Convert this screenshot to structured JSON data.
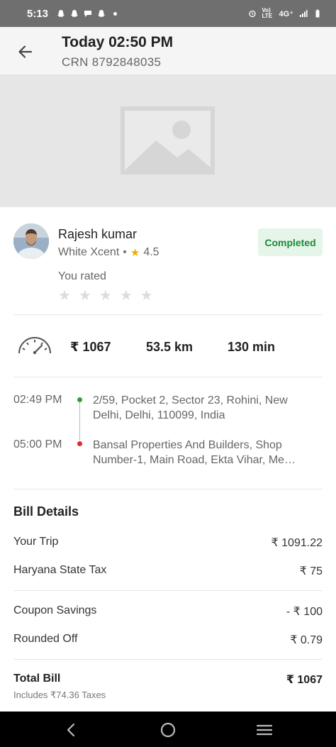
{
  "status_bar": {
    "time": "5:13",
    "network": "4G⁺",
    "volte": "Vo) LTE"
  },
  "header": {
    "title": "Today 02:50 PM",
    "crn": "CRN 8792848035"
  },
  "driver": {
    "name": "Rajesh kumar",
    "car": "White Xcent",
    "separator": "•",
    "rating": "4.5",
    "status": "Completed",
    "you_rated": "You rated",
    "user_stars": 0
  },
  "trip": {
    "fare": "₹ 1067",
    "distance": "53.5 km",
    "duration": "130 min"
  },
  "route": {
    "pickup_time": "02:49 PM",
    "pickup_address": "2/59, Pocket 2, Sector 23, Rohini, New Delhi, Delhi, 110099, India",
    "drop_time": "05:00 PM",
    "drop_address": "Bansal Properties And Builders, Shop Number-1, Main Road, Ekta Vihar, Me…"
  },
  "bill": {
    "title": "Bill Details",
    "items": [
      {
        "label": "Your Trip",
        "value": "₹ 1091.22"
      },
      {
        "label": "Haryana State Tax",
        "value": "₹ 75"
      },
      {
        "label": "Coupon Savings",
        "value": "- ₹ 100"
      },
      {
        "label": "Rounded Off",
        "value": "₹ 0.79"
      }
    ],
    "total_label": "Total Bill",
    "total_value": "₹ 1067",
    "taxes_note": "Includes ₹74.36 Taxes"
  },
  "colors": {
    "status_bar": "#6f6f6f",
    "badge_bg": "#e6f5ea",
    "badge_text": "#1a8a3a",
    "pickup_dot": "#2e9e3c",
    "drop_dot": "#e0263a",
    "star": "#f2a900"
  }
}
